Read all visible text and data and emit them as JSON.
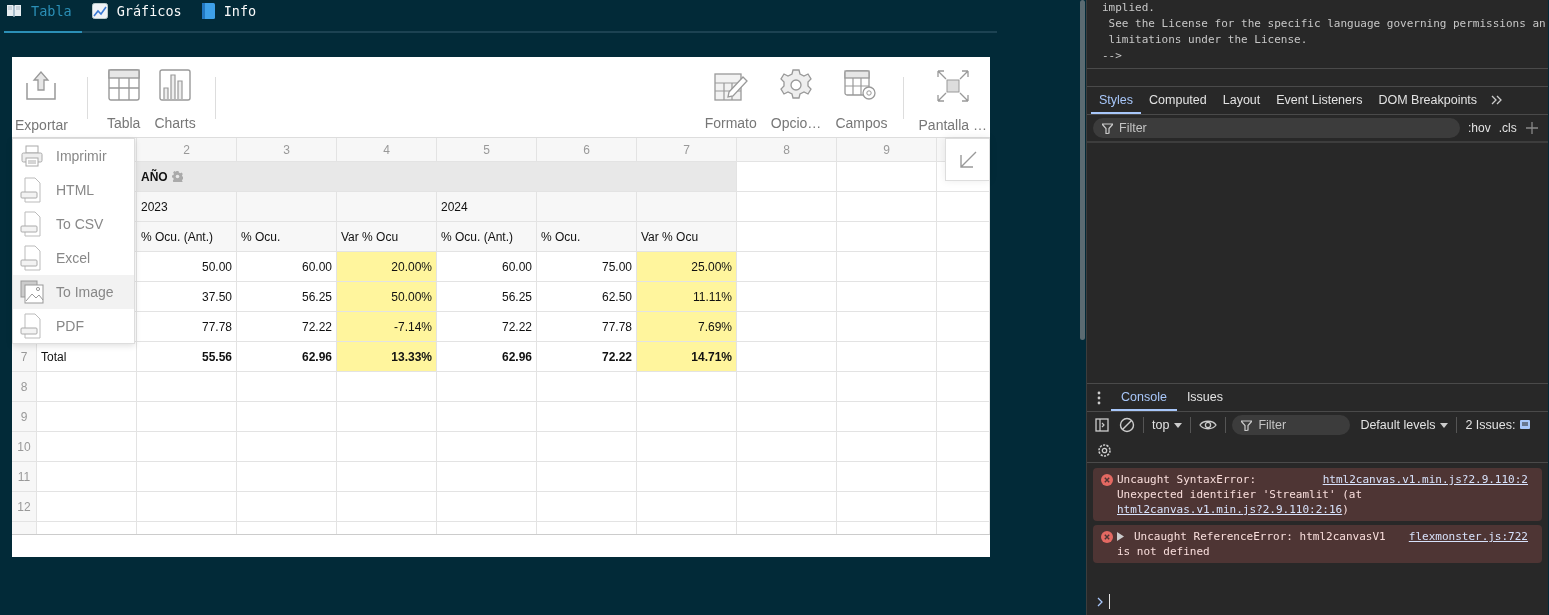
{
  "nav_tabs": [
    {
      "label": "Tabla",
      "selected": true,
      "kind": "open-book"
    },
    {
      "label": "Gráficos",
      "selected": false,
      "kind": "trend"
    },
    {
      "label": "Info",
      "selected": false,
      "kind": "blue-book"
    }
  ],
  "pivot": {
    "toolbar": {
      "left_groups": [
        [
          {
            "label": "Exportar",
            "kind": "export"
          }
        ],
        [
          {
            "label": "Tabla",
            "kind": "table"
          },
          {
            "label": "Charts",
            "kind": "chart"
          }
        ]
      ],
      "right_groups": [
        [
          {
            "label": "Formato",
            "kind": "format"
          },
          {
            "label": "Opcio…",
            "kind": "options"
          },
          {
            "label": "Campos",
            "kind": "fields"
          }
        ],
        [
          {
            "label": "Pantalla …",
            "kind": "fullscreen"
          }
        ]
      ]
    },
    "export_menu": [
      {
        "label": "Imprimir",
        "kind": "print",
        "selected": false
      },
      {
        "label": "HTML",
        "kind": "file",
        "selected": false
      },
      {
        "label": "To CSV",
        "kind": "file",
        "selected": false
      },
      {
        "label": "Excel",
        "kind": "file",
        "selected": false
      },
      {
        "label": "To Image",
        "kind": "image",
        "selected": true
      },
      {
        "label": "PDF",
        "kind": "file",
        "selected": false
      }
    ],
    "grid": {
      "column_numbers": [
        "2",
        "3",
        "4",
        "5",
        "6",
        "7",
        "8",
        "9"
      ],
      "column_field": "AÑO",
      "years": [
        {
          "label": "2023"
        },
        {
          "label": "2024"
        }
      ],
      "measures": [
        {
          "label": "% Ocu. (Ant.)",
          "highlight": false
        },
        {
          "label": "% Ocu.",
          "highlight": false
        },
        {
          "label": "Var % Ocu",
          "highlight": true
        },
        {
          "label": "% Ocu. (Ant.)",
          "highlight": false
        },
        {
          "label": "% Ocu.",
          "highlight": false
        },
        {
          "label": "Var % Ocu",
          "highlight": true
        }
      ],
      "rows": [
        {
          "kind": "data",
          "values": [
            "50.00",
            "60.00",
            "20.00%",
            "60.00",
            "75.00",
            "25.00%"
          ]
        },
        {
          "kind": "data",
          "values": [
            "37.50",
            "56.25",
            "50.00%",
            "56.25",
            "62.50",
            "11.11%"
          ]
        },
        {
          "kind": "data",
          "values": [
            "77.78",
            "72.22",
            "-7.14%",
            "72.22",
            "77.78",
            "7.69%"
          ]
        },
        {
          "kind": "total",
          "number": "7",
          "label": "Total",
          "values": [
            "55.56",
            "62.96",
            "13.33%",
            "62.96",
            "72.22",
            "14.71%"
          ]
        }
      ],
      "empty_row_numbers": [
        "8",
        "9",
        "10",
        "11",
        "12"
      ]
    }
  },
  "devtools": {
    "source_lines": [
      "implied.",
      " See the License for the specific language governing permissions an",
      " limitations under the License.",
      "-->"
    ],
    "panel_tabs": [
      {
        "label": "Styles",
        "selected": true
      },
      {
        "label": "Computed",
        "selected": false
      },
      {
        "label": "Layout",
        "selected": false
      },
      {
        "label": "Event Listeners",
        "selected": false
      },
      {
        "label": "DOM Breakpoints",
        "selected": false
      }
    ],
    "styles_filter": {
      "placeholder": "Filter"
    },
    "styles_buttons": [
      ":hov",
      ".cls"
    ],
    "drawer_tabs": [
      {
        "label": "Console",
        "selected": true
      },
      {
        "label": "Issues",
        "selected": false
      }
    ],
    "console_toolbar": {
      "context": "top",
      "filter": {
        "placeholder": "Filter"
      },
      "levels": "Default levels",
      "issues": "2 Issues:"
    },
    "messages": [
      {
        "kind": "error",
        "head": "Uncaught SyntaxError:",
        "source": "html2canvas.v1.min.js?2.9.110:2",
        "body": "Unexpected identifier 'Streamlit' (at ",
        "body_link": "html2canvas.v1.min.js?2.9.110:2:16",
        "body_end": ")"
      },
      {
        "kind": "group-error",
        "head": "Uncaught ReferenceError: html2canvasV1",
        "source": "flexmonster.js:722",
        "body": "is not defined"
      }
    ]
  }
}
